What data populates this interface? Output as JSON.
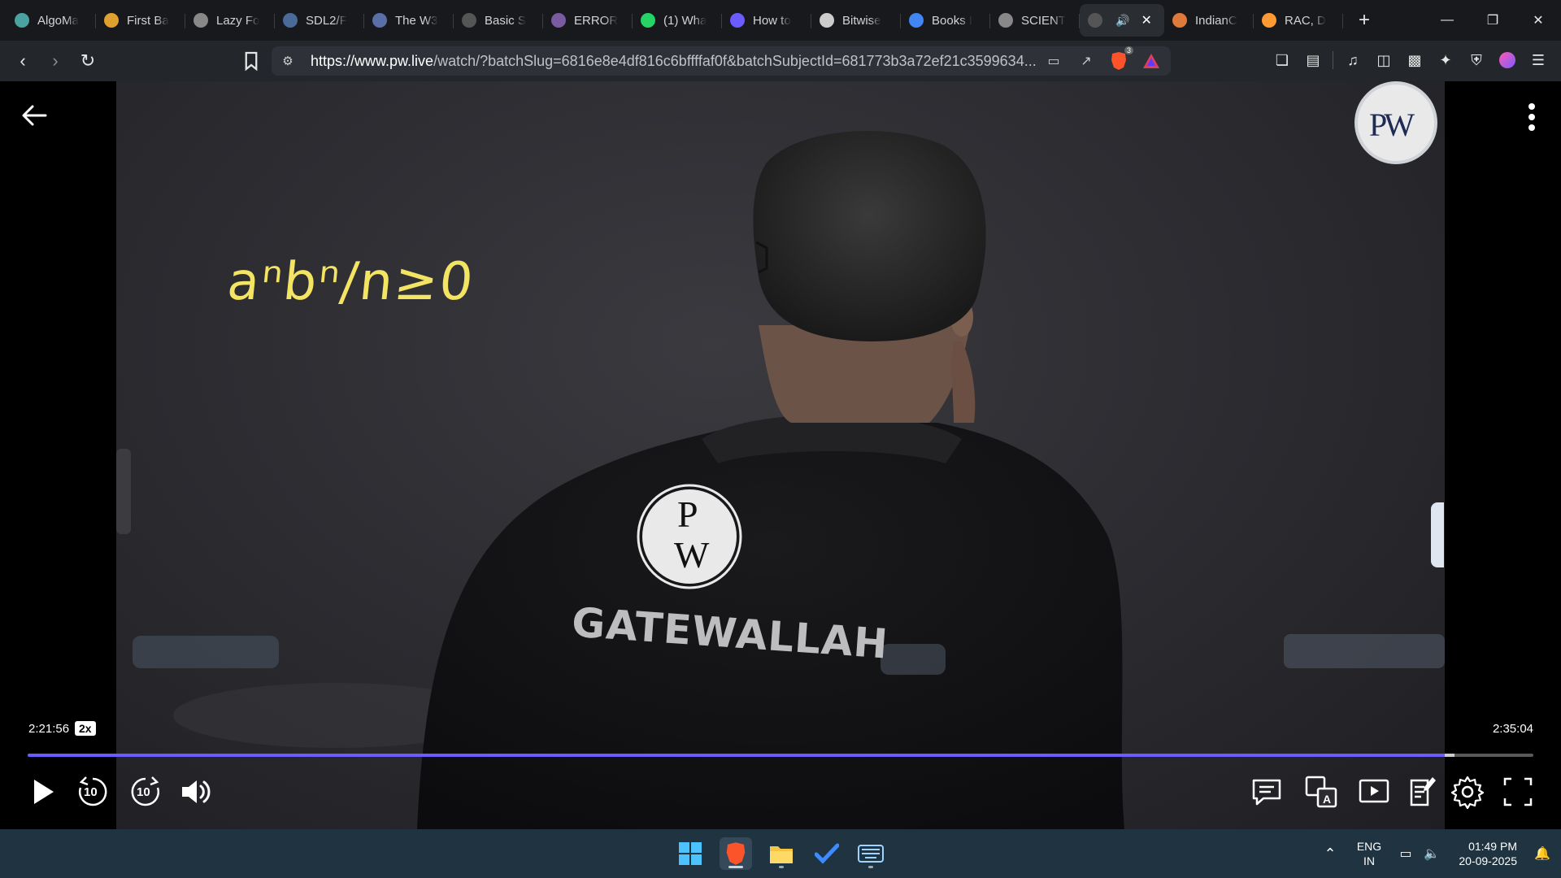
{
  "browser": {
    "tabs": [
      {
        "label": "AlgoMa",
        "icon": "algomaster-icon",
        "color": "#4aa3a0"
      },
      {
        "label": "First Ba",
        "icon": "first-bad-icon",
        "color": "#e0a030"
      },
      {
        "label": "Lazy Fo",
        "icon": "globe-icon",
        "color": "#888888"
      },
      {
        "label": "SDL2/F",
        "icon": "sdl-icon",
        "color": "#4a6a9a"
      },
      {
        "label": "The W3",
        "icon": "w3-icon",
        "color": "#5a6ea8"
      },
      {
        "label": "Basic S",
        "icon": "basic-icon",
        "color": "#555555"
      },
      {
        "label": "ERROR",
        "icon": "error-icon",
        "color": "#7a5aa0"
      },
      {
        "label": "(1) Wha",
        "icon": "whatsapp-icon",
        "color": "#25d366"
      },
      {
        "label": "How to",
        "icon": "howto-icon",
        "color": "#6a5cff"
      },
      {
        "label": "Bitwise",
        "icon": "bitwise-icon",
        "color": "#cccccc"
      },
      {
        "label": "Books I",
        "icon": "google-icon",
        "color": "#4285f4"
      },
      {
        "label": "SCIENT",
        "icon": "globe-icon",
        "color": "#888888"
      },
      {
        "label": "",
        "icon": "pw-tab-icon",
        "color": "#555555",
        "active": true
      },
      {
        "label": "IndianC",
        "icon": "indian-icon",
        "color": "#e07a3a"
      },
      {
        "label": "RAC, D",
        "icon": "india-flag-icon",
        "color": "#ff9933"
      }
    ],
    "new_tab": "+",
    "url_scheme_host": "https://www.pw.live",
    "url_rest": "/watch/?batchSlug=6816e8e4df816c6bffffaf0f&batchSubjectId=681773b3a72ef21c3599634...",
    "brave_badge": "3"
  },
  "board": {
    "chalk_text": "aⁿbⁿ/n≥0",
    "shirt_text": "GATEWALLAH",
    "logo_letters": "PW"
  },
  "player": {
    "current_time": "2:21:56",
    "speed": "2x",
    "total_time": "2:35:04",
    "progress": 0.9414,
    "buffered": 0.9475,
    "rewind_seconds": "10",
    "forward_seconds": "10"
  },
  "taskbar": {
    "lang_line1": "ENG",
    "lang_line2": "IN",
    "time": "01:49 PM",
    "date": "20-09-2025"
  }
}
